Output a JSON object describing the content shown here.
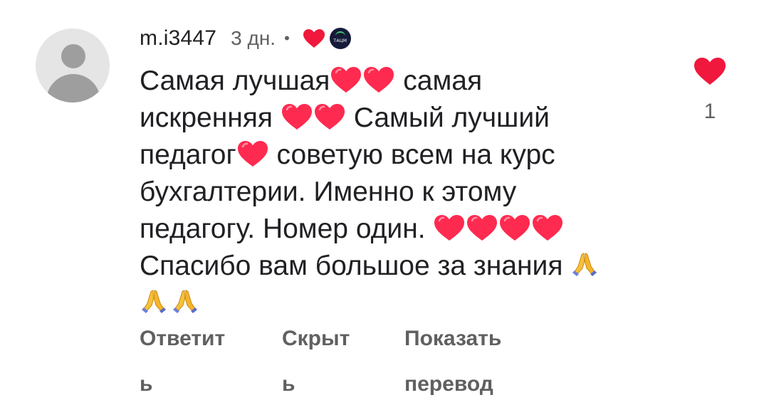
{
  "comment": {
    "username": "m.i3447",
    "timestamp": "3 дн.",
    "separator": "•",
    "channel_badge_text": "ТАЦМ",
    "body_lines": [
      [
        "Самая лучшая",
        "heart",
        "heart",
        " самая"
      ],
      [
        "искренняя ",
        "heart",
        "heart",
        " Самый лучший"
      ],
      [
        "педагог",
        "heart",
        " советую всем на курс"
      ],
      [
        "бухгалтерии. Именно к этому"
      ],
      [
        "педагогу. Номер один. ",
        "heart",
        "heart",
        "heart",
        "heart"
      ],
      [
        "Спасибо вам большое за знания ",
        "pray"
      ],
      [
        "pray",
        "pray"
      ]
    ],
    "likes": "1"
  },
  "actions": {
    "reply": [
      "Ответит",
      "ь"
    ],
    "hide": [
      "Скрыт",
      "ь"
    ],
    "translate": [
      "Показать",
      "перевод"
    ]
  },
  "colors": {
    "heart": "#ff2a4f",
    "like_heart": "#f0183c",
    "secondary_text": "#606060",
    "avatar_bg": "#e5e5e5",
    "avatar_fg": "#9e9e9e"
  },
  "icons": {
    "heart": "heart-icon",
    "pray": "folded-hands-icon",
    "like": "like-heart-icon",
    "avatar": "default-avatar-icon"
  }
}
